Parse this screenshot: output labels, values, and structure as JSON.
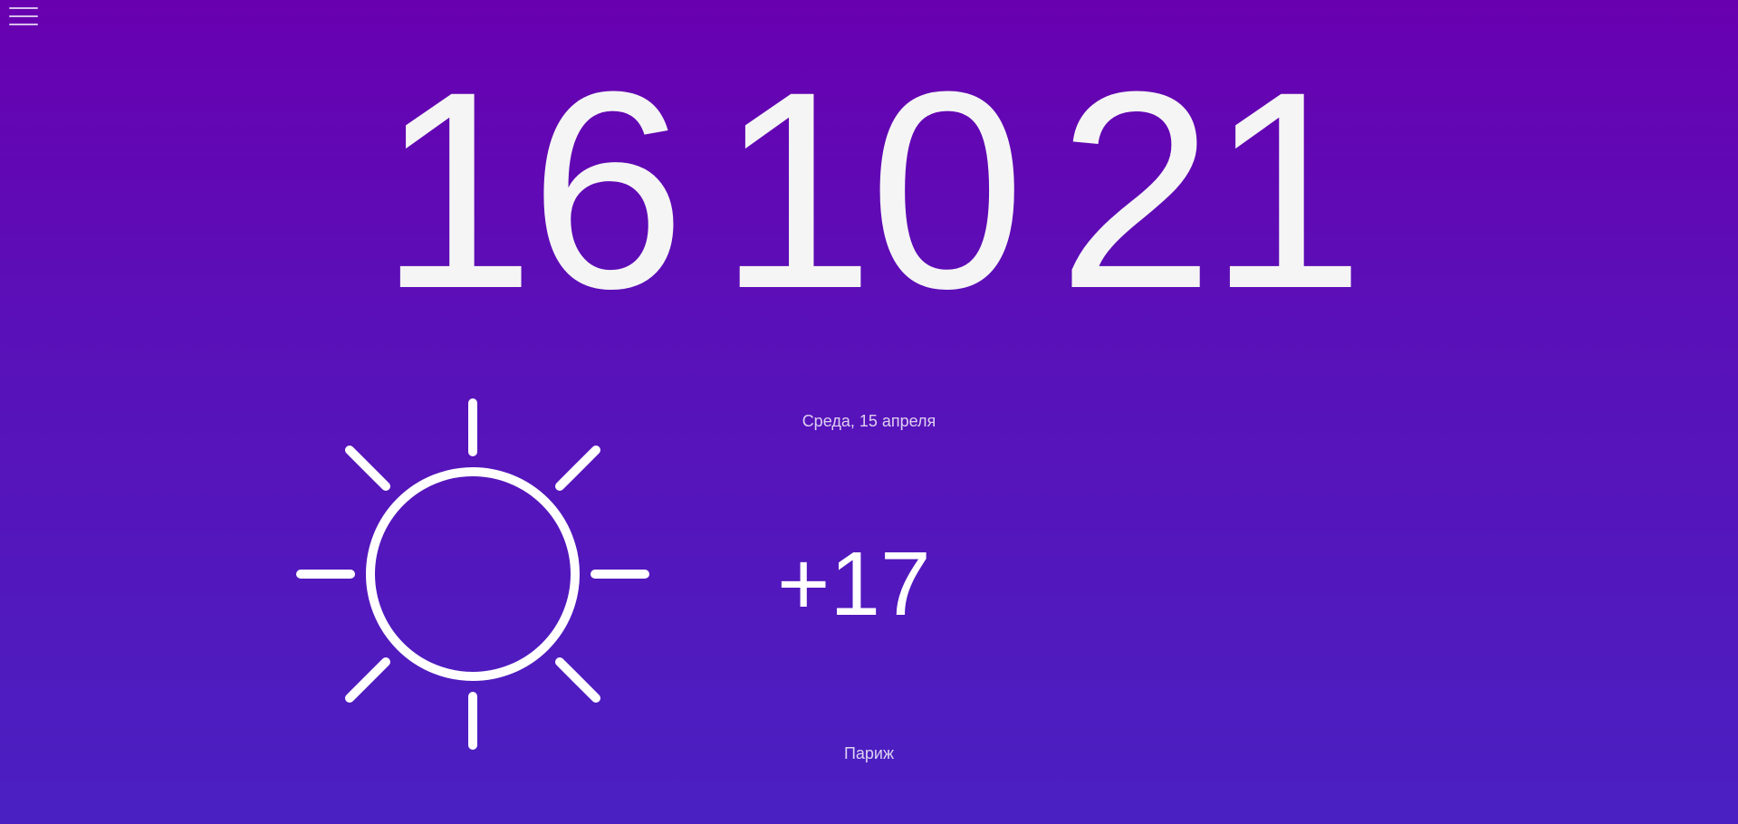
{
  "menu": {
    "icon": "hamburger-menu-icon"
  },
  "clock": {
    "hours": "16",
    "minutes": "10",
    "seconds": "21"
  },
  "date": "Среда, 15 апреля",
  "weather": {
    "condition_icon": "sun-icon",
    "temperature": "+17",
    "city": "Париж"
  },
  "colors": {
    "background_top": "#6800b0",
    "background_bottom": "#4a20c2",
    "text": "#f5f5f5"
  }
}
